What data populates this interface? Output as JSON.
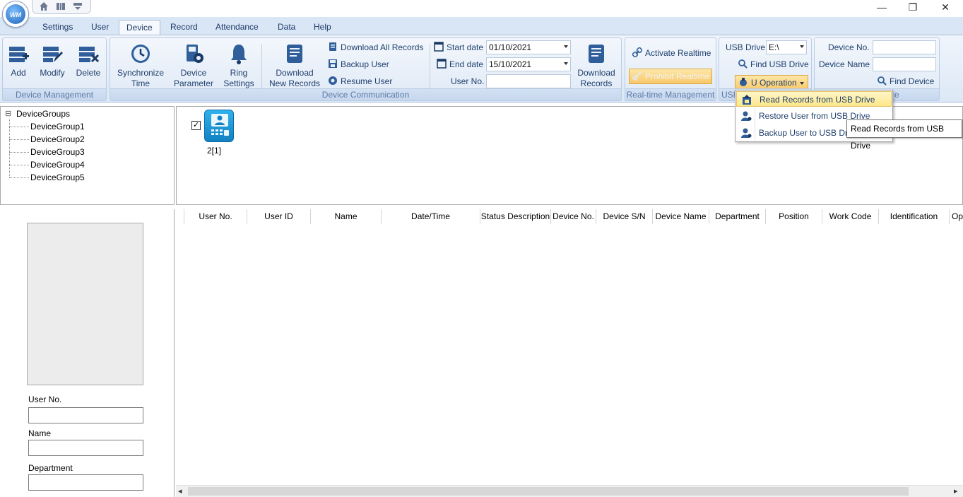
{
  "window": {
    "minimize": "—",
    "restore": "❐",
    "close": "✕"
  },
  "logo_text": "WM",
  "quick_access": {
    "home": "home-icon",
    "attendance": "attendance-icon",
    "dropdown": "dropdown-icon"
  },
  "tabs": [
    {
      "label": "Settings"
    },
    {
      "label": "User"
    },
    {
      "label": "Device",
      "active": true
    },
    {
      "label": "Record"
    },
    {
      "label": "Attendance"
    },
    {
      "label": "Data"
    },
    {
      "label": "Help"
    }
  ],
  "device_management": {
    "title": "Device Management",
    "add": "Add",
    "modify": "Modify",
    "delete": "Delete"
  },
  "device_communication": {
    "title": "Device Communication",
    "sync_time_line1": "Synchronize",
    "sync_time_line2": "Time",
    "device_param_line1": "Device",
    "device_param_line2": "Parameter",
    "ring_line1": "Ring",
    "ring_line2": "Settings",
    "download_new_line1": "Download",
    "download_new_line2": "New Records",
    "download_all": "Download All Records",
    "backup_user": "Backup User",
    "resume_user": "Resume User",
    "start_date_label": "Start date",
    "start_date_value": "01/10/2021",
    "end_date_label": "End date",
    "end_date_value": "15/10/2021",
    "user_no_label": "User No.",
    "user_no_value": "",
    "download_records_line1": "Download",
    "download_records_line2": "Records"
  },
  "realtime": {
    "title": "Real-time Management",
    "activate": "Activate Realtime",
    "prohibit": "Prohibit Realtime"
  },
  "usb": {
    "title_partial": "USB",
    "drive_label": "USB Drive",
    "drive_value": "E:\\",
    "find_usb": "Find USB Drive",
    "u_operation": "U Operation"
  },
  "search_device": {
    "title_partial": "e",
    "device_no_label": "Device No.",
    "device_no_value": "",
    "device_name_label": "Device Name",
    "device_name_value": "",
    "find_device": "Find Device"
  },
  "u_operation_menu": [
    {
      "label": "Read Records from USB Drive",
      "highlighted": true
    },
    {
      "label": "Restore User from USB Drive"
    },
    {
      "label": "Backup User to USB Drive"
    }
  ],
  "tooltip": "Read Records from USB Drive",
  "tree": {
    "root": "DeviceGroups",
    "expander": "⊟",
    "children": [
      "DeviceGroup1",
      "DeviceGroup2",
      "DeviceGroup3",
      "DeviceGroup4",
      "DeviceGroup5"
    ]
  },
  "device_tile": {
    "label": "2[1]",
    "checked": true,
    "checkmark": "✓"
  },
  "user_info": {
    "user_no_label": "User No.",
    "user_no_value": "",
    "name_label": "Name",
    "name_value": "",
    "department_label": "Department",
    "department_value": ""
  },
  "record_columns": [
    "User No.",
    "User ID",
    "Name",
    "Date/Time",
    "Status Description",
    "Device No.",
    "Device S/N",
    "Device Name",
    "Department",
    "Position",
    "Work Code",
    "Identification",
    "Op"
  ],
  "scrollbar": {
    "left_arrow": "◂",
    "right_arrow": "▸"
  },
  "colors": {
    "ribbon_accent": "#1e3a66",
    "highlight": "#fde78a",
    "device_icon": "#1b9bd8"
  }
}
